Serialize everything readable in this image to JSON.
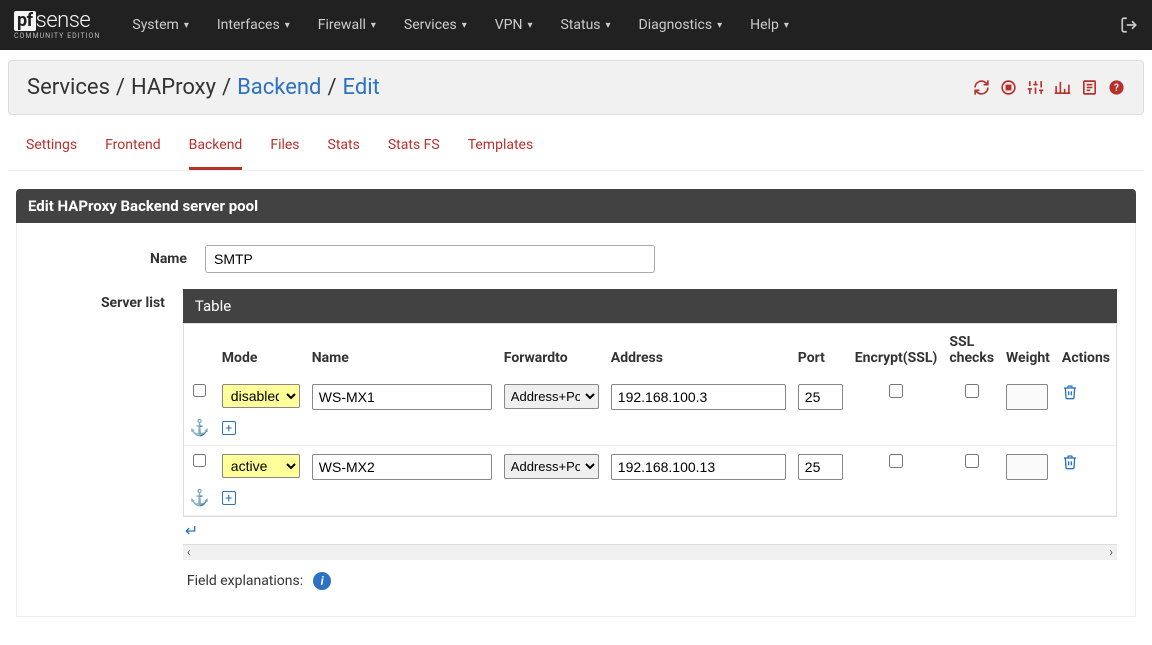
{
  "logo": {
    "box": "pf",
    "text": "sense",
    "sub": "COMMUNITY EDITION"
  },
  "nav": [
    "System",
    "Interfaces",
    "Firewall",
    "Services",
    "VPN",
    "Status",
    "Diagnostics",
    "Help"
  ],
  "breadcrumb": {
    "a": "Services",
    "b": "HAProxy",
    "c": "Backend",
    "d": "Edit"
  },
  "tabs": [
    "Settings",
    "Frontend",
    "Backend",
    "Files",
    "Stats",
    "Stats FS",
    "Templates"
  ],
  "active_tab": 2,
  "panel_title": "Edit HAProxy Backend server pool",
  "name_label": "Name",
  "name_value": "SMTP",
  "serverlist_label": "Server list",
  "table_title": "Table",
  "columns": {
    "mode": "Mode",
    "name": "Name",
    "forwardto": "Forwardto",
    "address": "Address",
    "port": "Port",
    "encrypt": "Encrypt(SSL)",
    "sslchecks": "SSL checks",
    "weight": "Weight",
    "actions": "Actions"
  },
  "fwd_option": "Address+Port",
  "servers": [
    {
      "mode": "disabled",
      "name": "WS-MX1",
      "address": "192.168.100.3",
      "port": "25",
      "encrypt": false,
      "sslchecks": false,
      "weight": ""
    },
    {
      "mode": "active",
      "name": "WS-MX2",
      "address": "192.168.100.13",
      "port": "25",
      "encrypt": false,
      "sslchecks": false,
      "weight": ""
    }
  ],
  "field_explanations": "Field explanations:"
}
